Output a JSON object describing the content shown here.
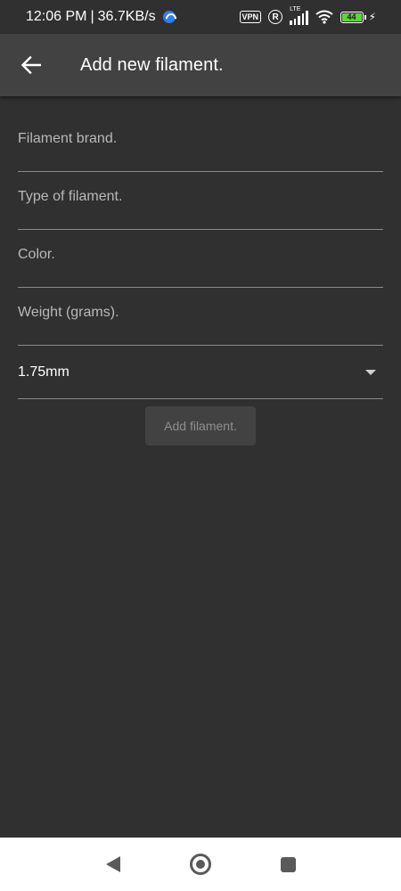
{
  "status_bar": {
    "time": "12:06 PM",
    "separator": "|",
    "speed": "36.7KB/s",
    "vpn": "VPN",
    "r_badge": "R",
    "lte": "LTE",
    "battery": "44",
    "battery_color": "#62d33f"
  },
  "app_bar": {
    "title": "Add new filament.",
    "back_icon": "arrow-left-icon"
  },
  "form": {
    "brand_placeholder": "Filament brand.",
    "type_placeholder": "Type of filament.",
    "color_placeholder": "Color.",
    "weight_placeholder": "Weight (grams).",
    "diameter_value": "1.75mm",
    "submit_label": "Add filament."
  },
  "nav_bar": {
    "back_icon": "triangle-back-icon",
    "home_icon": "circle-home-icon",
    "recents_icon": "square-recents-icon"
  },
  "colors": {
    "background": "#303030",
    "app_bar": "#424242",
    "button": "#424242"
  }
}
